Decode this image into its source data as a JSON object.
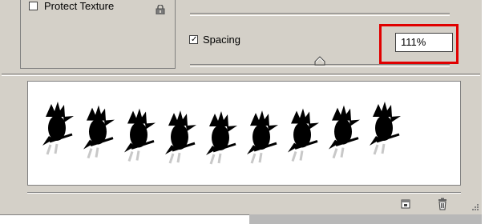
{
  "brush_options": {
    "protect_texture": {
      "label": "Protect Texture",
      "checked": false
    },
    "spacing": {
      "label": "Spacing",
      "checked": true,
      "value": "111%",
      "slider_fraction": 0.5
    }
  },
  "preview": {
    "stroke_count": 9,
    "color": "#000000"
  },
  "highlight_color": "#e00000",
  "icons": {
    "lock": "lock-icon",
    "new_preset": "new-preset-icon",
    "delete": "trash-icon",
    "resize": "resize-grip-icon"
  }
}
